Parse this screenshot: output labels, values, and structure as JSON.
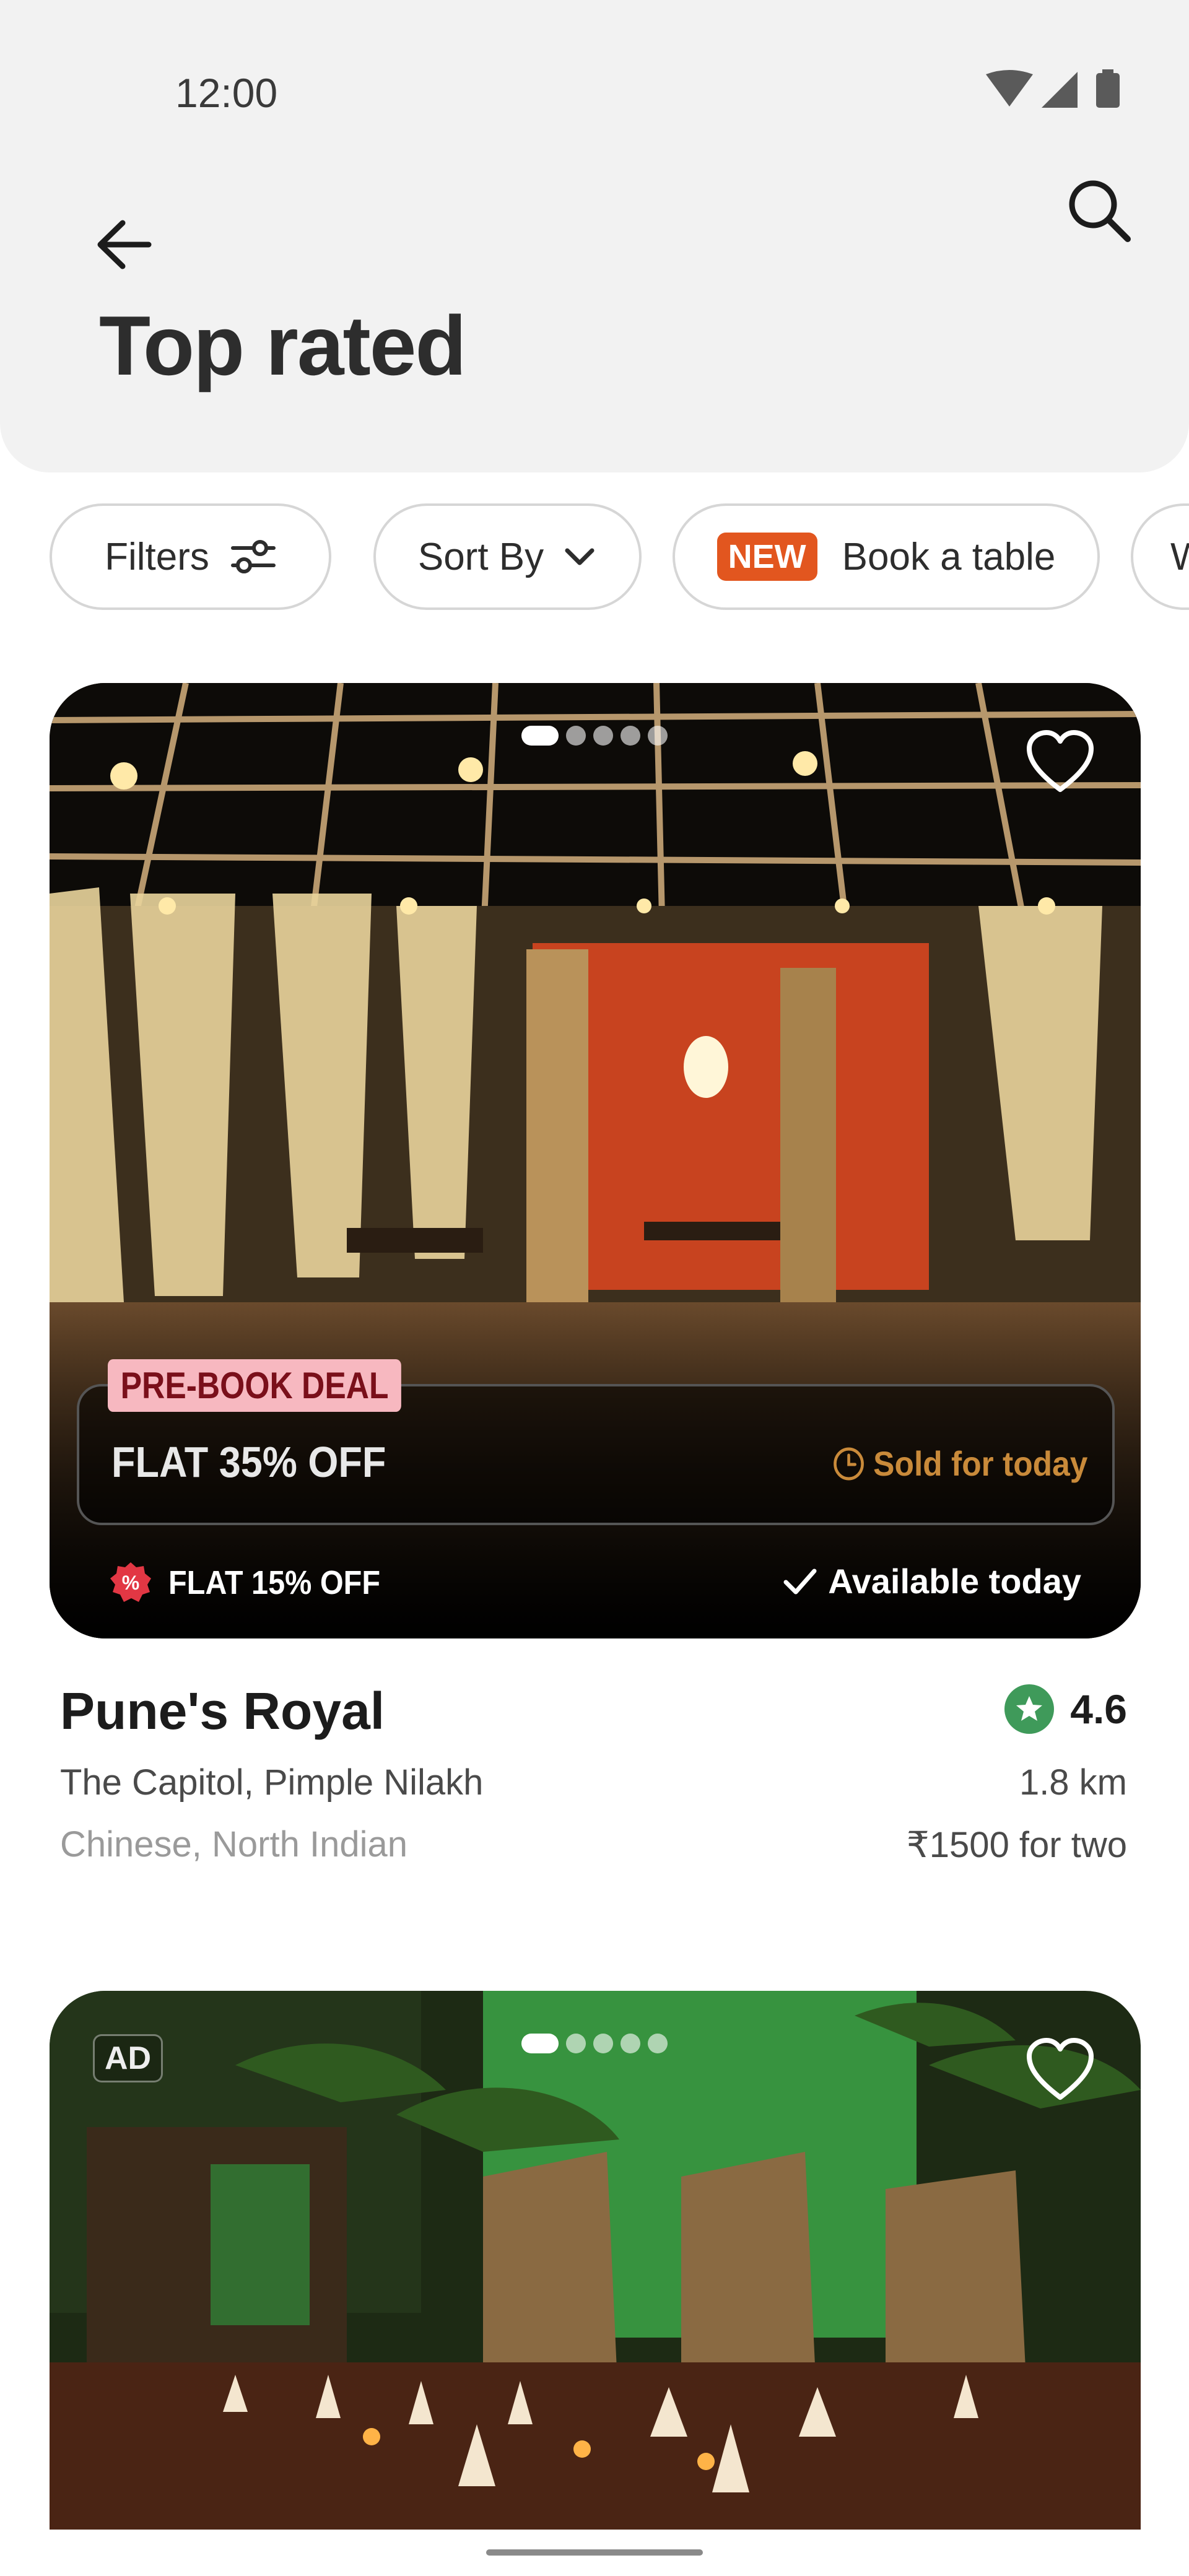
{
  "status_bar": {
    "time": "12:00"
  },
  "header": {
    "title": "Top rated"
  },
  "chips": {
    "filters": "Filters",
    "sort_by": "Sort By",
    "new_badge": "NEW",
    "book_table": "Book a table",
    "partial": "W"
  },
  "restaurants": [
    {
      "deal_tag": "PRE-BOOK DEAL",
      "deal_text": "FLAT 35% OFF",
      "deal_status": "Sold for today",
      "offer": "FLAT 15% OFF",
      "availability": "Available today",
      "name": "Pune's Royal",
      "rating": "4.6",
      "location": "The Capitol, Pimple Nilakh",
      "distance": "1.8 km",
      "cuisine": "Chinese, North Indian",
      "price": "₹1500 for two",
      "image_pages": 5,
      "image_current_page": 1
    },
    {
      "ad_label": "AD",
      "image_pages": 5,
      "image_current_page": 1
    }
  ],
  "colors": {
    "header_bg": "#f2f2f2",
    "new_badge": "#e2561f",
    "deal_tag_bg": "#f7b8c0",
    "sold_status": "#c98a3a",
    "rating_green": "#3f9a5a",
    "offer_red": "#e23744"
  }
}
